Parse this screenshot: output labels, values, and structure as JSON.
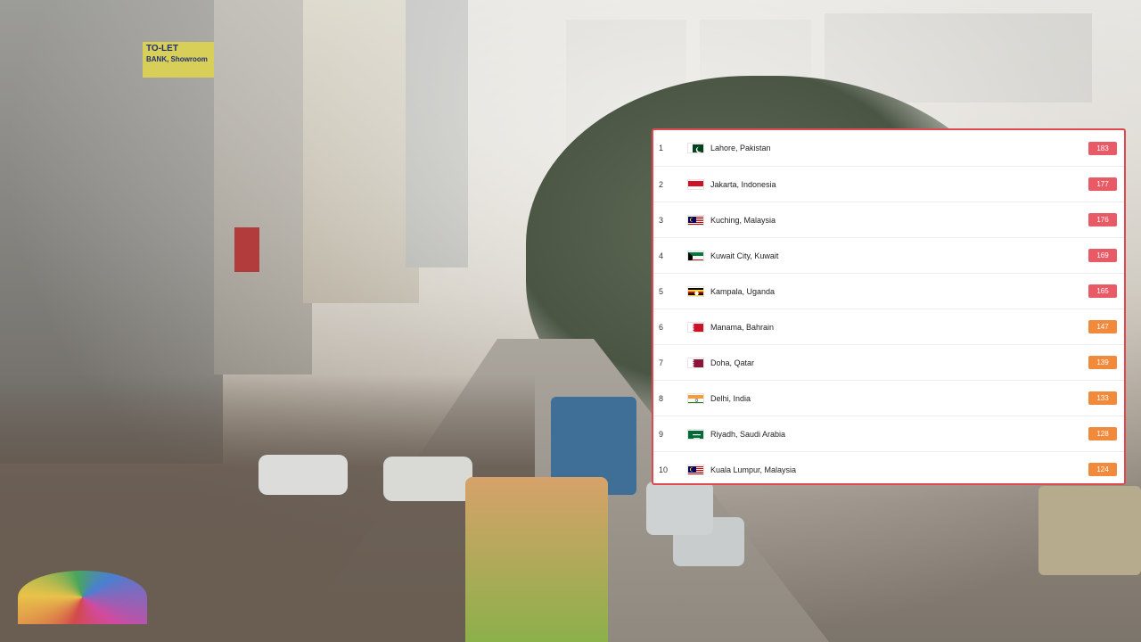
{
  "background": {
    "signs": [
      "TO-LET",
      "BANK, Showroom"
    ]
  },
  "ranking": {
    "rows": [
      {
        "rank": "1",
        "city": "Lahore, Pakistan",
        "flag": "pakistan-flag-icon",
        "aqi": "183",
        "level": "red"
      },
      {
        "rank": "2",
        "city": "Jakarta, Indonesia",
        "flag": "indonesia-flag-icon",
        "aqi": "177",
        "level": "red"
      },
      {
        "rank": "3",
        "city": "Kuching, Malaysia",
        "flag": "malaysia-flag-icon",
        "aqi": "176",
        "level": "red"
      },
      {
        "rank": "4",
        "city": "Kuwait City, Kuwait",
        "flag": "kuwait-flag-icon",
        "aqi": "169",
        "level": "red"
      },
      {
        "rank": "5",
        "city": "Kampala, Uganda",
        "flag": "uganda-flag-icon",
        "aqi": "165",
        "level": "red"
      },
      {
        "rank": "6",
        "city": "Manama, Bahrain",
        "flag": "bahrain-flag-icon",
        "aqi": "147",
        "level": "orange"
      },
      {
        "rank": "7",
        "city": "Doha, Qatar",
        "flag": "qatar-flag-icon",
        "aqi": "139",
        "level": "orange"
      },
      {
        "rank": "8",
        "city": "Delhi, India",
        "flag": "india-flag-icon",
        "aqi": "133",
        "level": "orange"
      },
      {
        "rank": "9",
        "city": "Riyadh, Saudi Arabia",
        "flag": "saudi-arabia-flag-icon",
        "aqi": "128",
        "level": "orange"
      },
      {
        "rank": "10",
        "city": "Kuala Lumpur, Malaysia",
        "flag": "malaysia-flag-icon",
        "aqi": "124",
        "level": "orange"
      }
    ]
  },
  "colors": {
    "panel_border": "#e0484f",
    "aqi_red": "#e85a66",
    "aqi_orange": "#f28a3c"
  }
}
